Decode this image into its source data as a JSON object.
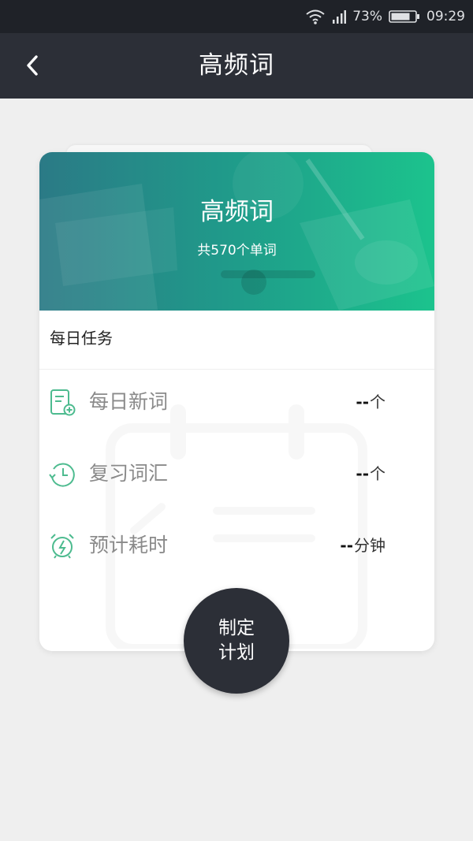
{
  "status": {
    "battery": "73%",
    "time": "09:29"
  },
  "appbar": {
    "title": "高频词"
  },
  "banner": {
    "title": "高频词",
    "subtitle": "共570个单词"
  },
  "tasks": {
    "heading": "每日任务",
    "rows": [
      {
        "icon": "new-words-icon",
        "label": "每日新词",
        "value": "--",
        "unit": "个"
      },
      {
        "icon": "review-clock-icon",
        "label": "复习词汇",
        "value": "--",
        "unit": "个"
      },
      {
        "icon": "alarm-clock-icon",
        "label": "预计耗时",
        "value": "--",
        "unit": "分钟"
      }
    ]
  },
  "plan_button": {
    "line1": "制定",
    "line2": "计划"
  },
  "colors": {
    "appbar": "#2c2f37",
    "accent": "#1cc38d",
    "icon": "#4dbb8f"
  }
}
